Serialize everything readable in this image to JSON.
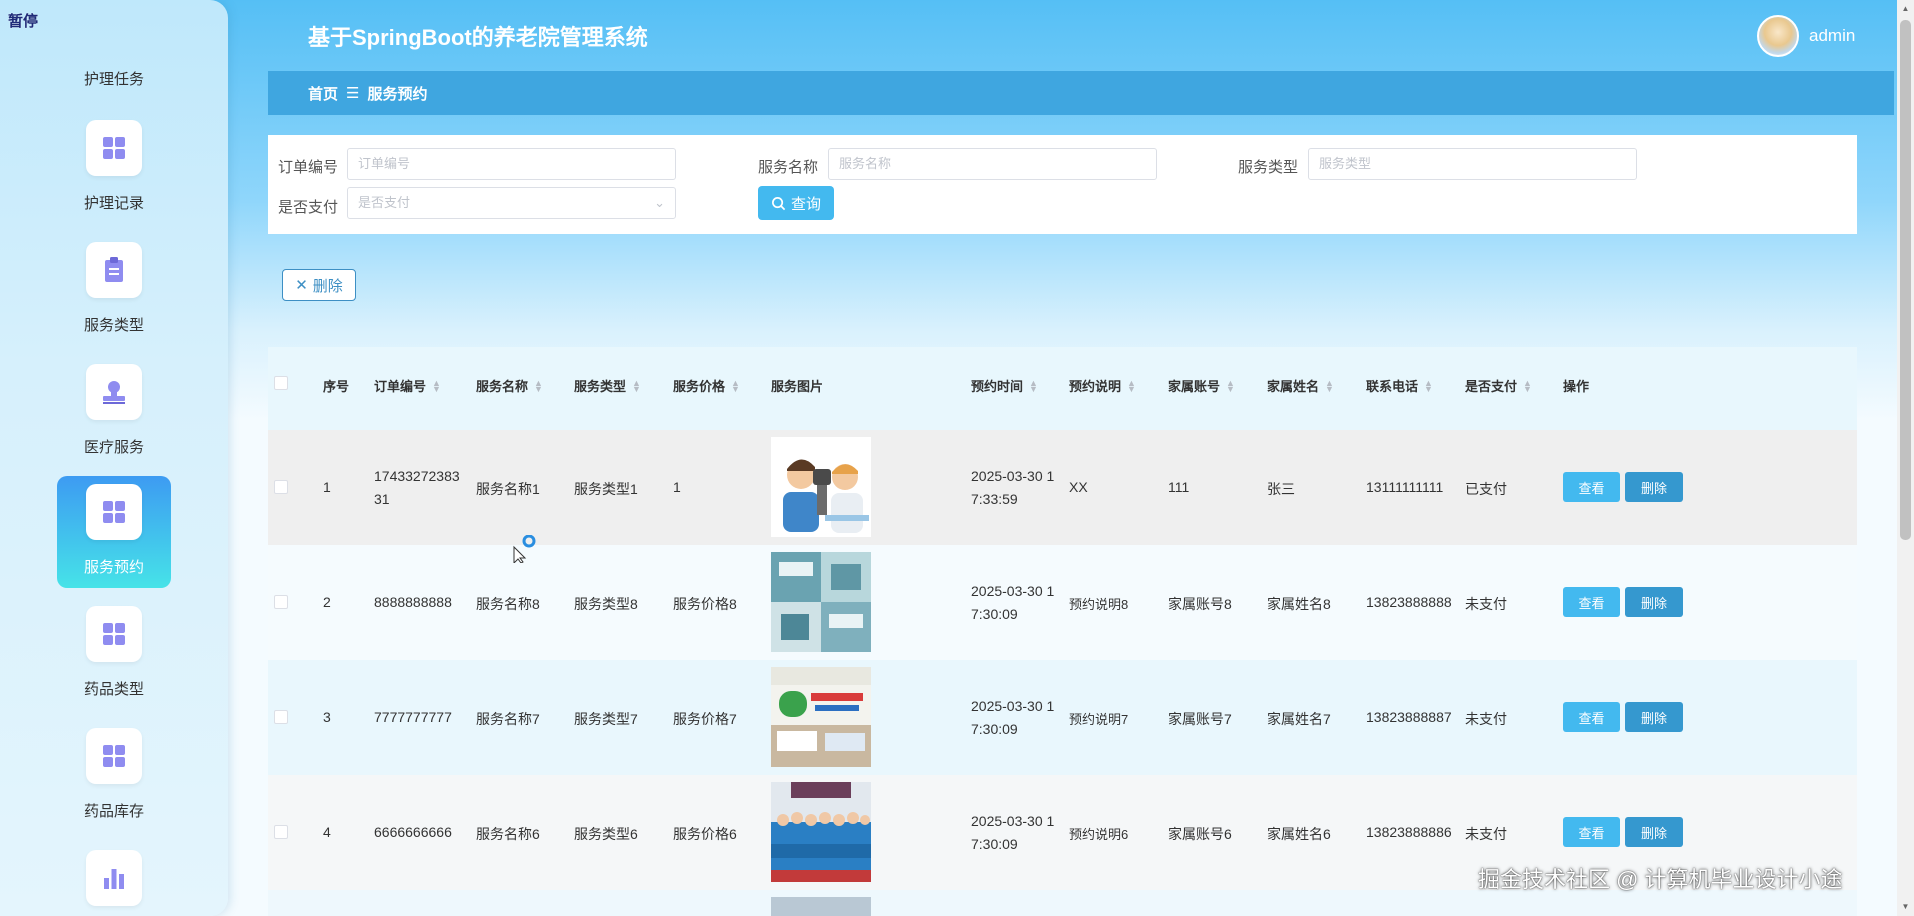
{
  "sidebar": {
    "top_label": "暂停",
    "items": [
      {
        "label": "护理任务",
        "icon": "grid-icon",
        "active": false
      },
      {
        "label": "护理记录",
        "icon": "grid-icon",
        "active": false
      },
      {
        "label": "服务类型",
        "icon": "clipboard-icon",
        "active": false
      },
      {
        "label": "医疗服务",
        "icon": "stamp-icon",
        "active": false
      },
      {
        "label": "服务预约",
        "icon": "grid-icon",
        "active": true
      },
      {
        "label": "药品类型",
        "icon": "grid-icon",
        "active": false
      },
      {
        "label": "药品库存",
        "icon": "grid-icon",
        "active": false
      },
      {
        "label": "",
        "icon": "bar-chart-icon",
        "active": false
      }
    ]
  },
  "header": {
    "title": "基于SpringBoot的养老院管理系统",
    "username": "admin"
  },
  "breadcrumb": {
    "home": "首页",
    "separator": "☰",
    "current": "服务预约"
  },
  "search": {
    "order_no_label": "订单编号",
    "order_no_placeholder": "订单编号",
    "service_name_label": "服务名称",
    "service_name_placeholder": "服务名称",
    "service_type_label": "服务类型",
    "service_type_placeholder": "服务类型",
    "paid_label": "是否支付",
    "paid_placeholder": "是否支付",
    "query_button": "查询"
  },
  "toolbar": {
    "delete_label": "删除"
  },
  "table": {
    "headers": {
      "index": "序号",
      "order_no": "订单编号",
      "service_name": "服务名称",
      "service_type": "服务类型",
      "service_price": "服务价格",
      "service_image": "服务图片",
      "booking_time": "预约时间",
      "booking_note": "预约说明",
      "family_account": "家属账号",
      "family_name": "家属姓名",
      "phone": "联系电话",
      "paid": "是否支付",
      "actions": "操作"
    },
    "rows": [
      {
        "index": "1",
        "order_no_1": "17433272383",
        "order_no_2": "31",
        "service_name": "服务名称1",
        "service_type": "服务类型1",
        "service_price": "1",
        "time_1": "2025-03-30 1",
        "time_2": "7:33:59",
        "note": "XX",
        "family_account": "111",
        "family_name": "张三",
        "phone": "13111111111",
        "paid": "已支付",
        "view": "查看",
        "delete": "删除"
      },
      {
        "index": "2",
        "order_no_1": "8888888888",
        "order_no_2": "",
        "service_name": "服务名称8",
        "service_type": "服务类型8",
        "service_price": "服务价格8",
        "time_1": "2025-03-30 1",
        "time_2": "7:30:09",
        "note": "预约说明8",
        "family_account": "家属账号8",
        "family_name": "家属姓名8",
        "phone": "13823888888",
        "paid": "未支付",
        "view": "查看",
        "delete": "删除"
      },
      {
        "index": "3",
        "order_no_1": "7777777777",
        "order_no_2": "",
        "service_name": "服务名称7",
        "service_type": "服务类型7",
        "service_price": "服务价格7",
        "time_1": "2025-03-30 1",
        "time_2": "7:30:09",
        "note": "预约说明7",
        "family_account": "家属账号7",
        "family_name": "家属姓名7",
        "phone": "13823888887",
        "paid": "未支付",
        "view": "查看",
        "delete": "删除"
      },
      {
        "index": "4",
        "order_no_1": "6666666666",
        "order_no_2": "",
        "service_name": "服务名称6",
        "service_type": "服务类型6",
        "service_price": "服务价格6",
        "time_1": "2025-03-30 1",
        "time_2": "7:30:09",
        "note": "预约说明6",
        "family_account": "家属账号6",
        "family_name": "家属姓名6",
        "phone": "13823888886",
        "paid": "未支付",
        "view": "查看",
        "delete": "删除"
      }
    ]
  },
  "watermark": "掘金技术社区 @ 计算机毕业设计小途",
  "colors": {
    "accent": "#43b9ef",
    "active_menu_top": "#3d9bf2",
    "active_menu_bottom": "#46e3e8",
    "breadcrumb_bg": "#3fa6e0",
    "delete_btn": "#3598cf",
    "icon_purple": "#8f8cf0"
  }
}
